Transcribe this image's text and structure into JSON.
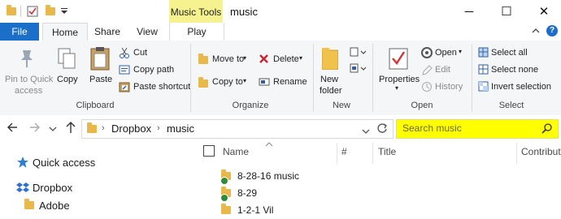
{
  "titlebar": {
    "contextual_label": "Music Tools",
    "title": "music",
    "minimize_glyph": "─",
    "maximize_glyph": "☐",
    "close_glyph": "✕"
  },
  "tabs": {
    "file": "File",
    "home": "Home",
    "share": "Share",
    "view": "View",
    "play": "Play"
  },
  "ribbon": {
    "clipboard": {
      "pin": "Pin to Quick",
      "pin2": "access",
      "copy": "Copy",
      "paste": "Paste",
      "cut": "Cut",
      "copy_path": "Copy path",
      "paste_shortcut": "Paste shortcut",
      "group": "Clipboard"
    },
    "organize": {
      "move_to": "Move to",
      "copy_to": "Copy to",
      "delete": "Delete",
      "rename": "Rename",
      "group": "Organize"
    },
    "new": {
      "new_folder": "New",
      "new_folder2": "folder",
      "group": "New"
    },
    "open": {
      "properties": "Properties",
      "open": "Open",
      "edit": "Edit",
      "history": "History",
      "group": "Open"
    },
    "select": {
      "select_all": "Select all",
      "select_none": "Select none",
      "invert": "Invert selection",
      "group": "Select"
    }
  },
  "address": {
    "crumbs": [
      "Dropbox",
      "music"
    ],
    "search_placeholder": "Search music"
  },
  "nav": {
    "quick_access": "Quick access",
    "dropbox": "Dropbox",
    "partial": "Adobe"
  },
  "columns": {
    "name": "Name",
    "number": "#",
    "title": "Title",
    "contributing": "Contribut"
  },
  "files": [
    "8-28-16 music",
    "8-29",
    "1-2-1 Vil"
  ],
  "colors": {
    "file_tab": "#1c6fc9",
    "contextual": "#f6f28f",
    "search_highlight": "#ffff00",
    "folder": "#e8b84a",
    "synced": "#2e8b3a"
  }
}
